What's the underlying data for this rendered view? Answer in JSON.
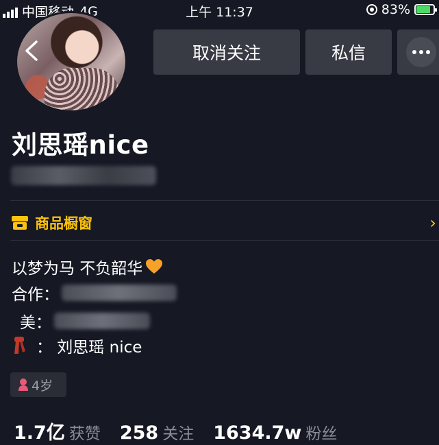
{
  "status_bar": {
    "carrier": "中国移动",
    "network": "4G",
    "time": "上午 11:37",
    "battery": "83%",
    "battery_level": 0.83
  },
  "header": {
    "unfollow_label": "取消关注",
    "message_label": "私信"
  },
  "profile": {
    "username": "刘思瑶nice"
  },
  "shop": {
    "label": "商品橱窗",
    "chevron": "›"
  },
  "bio": {
    "line1": "以梦为马 不负韶华",
    "line2_label": "合作：",
    "line3_label": "美：",
    "line4_text": "：  刘思瑶 nice"
  },
  "tag": {
    "age": "4岁"
  },
  "stats": [
    {
      "value": "1.7亿",
      "label": "获赞"
    },
    {
      "value": "258",
      "label": "关注"
    },
    {
      "value": "1634.7w",
      "label": "粉丝"
    }
  ],
  "colors": {
    "background": "#161823",
    "accent": "#fcc20e",
    "button": "#393b44"
  },
  "icons": [
    "back-arrow-icon",
    "more-dots-icon",
    "shop-icon",
    "heart-icon",
    "scarf-icon",
    "female-icon"
  ]
}
